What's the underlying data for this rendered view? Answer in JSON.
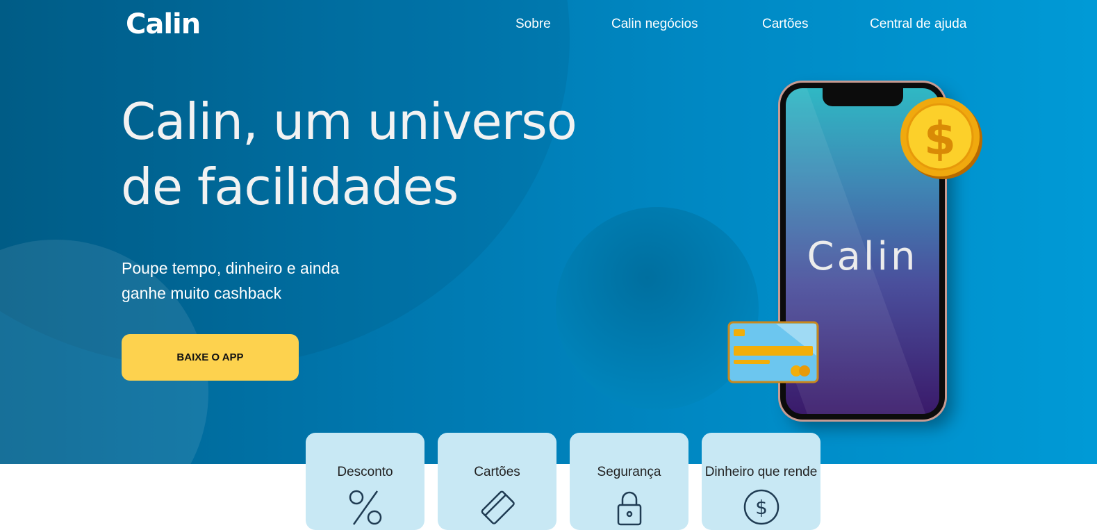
{
  "brand": {
    "name": "Calin"
  },
  "nav": {
    "items": [
      "Sobre",
      "Calin negócios",
      "Cartões",
      "Central de ajuda"
    ]
  },
  "hero": {
    "headline_line1": "Calin, um universo",
    "headline_line2": "de facilidades",
    "subtitle_line1": "Poupe tempo, dinheiro e ainda",
    "subtitle_line2": "ganhe muito cashback",
    "cta_label": "BAIXE O APP"
  },
  "phone": {
    "screen_text": "Calin"
  },
  "features": [
    {
      "label": "Desconto",
      "icon": "percent-icon"
    },
    {
      "label": "Cartões",
      "icon": "credit-card-icon"
    },
    {
      "label": "Segurança",
      "icon": "lock-icon"
    },
    {
      "label": "Dinheiro que rende",
      "icon": "dollar-circle-icon"
    }
  ],
  "colors": {
    "hero_gradient_start": "#00628f",
    "hero_gradient_end": "#009ad6",
    "cta": "#fdd24e",
    "feature_card": "#c8e8f4"
  }
}
